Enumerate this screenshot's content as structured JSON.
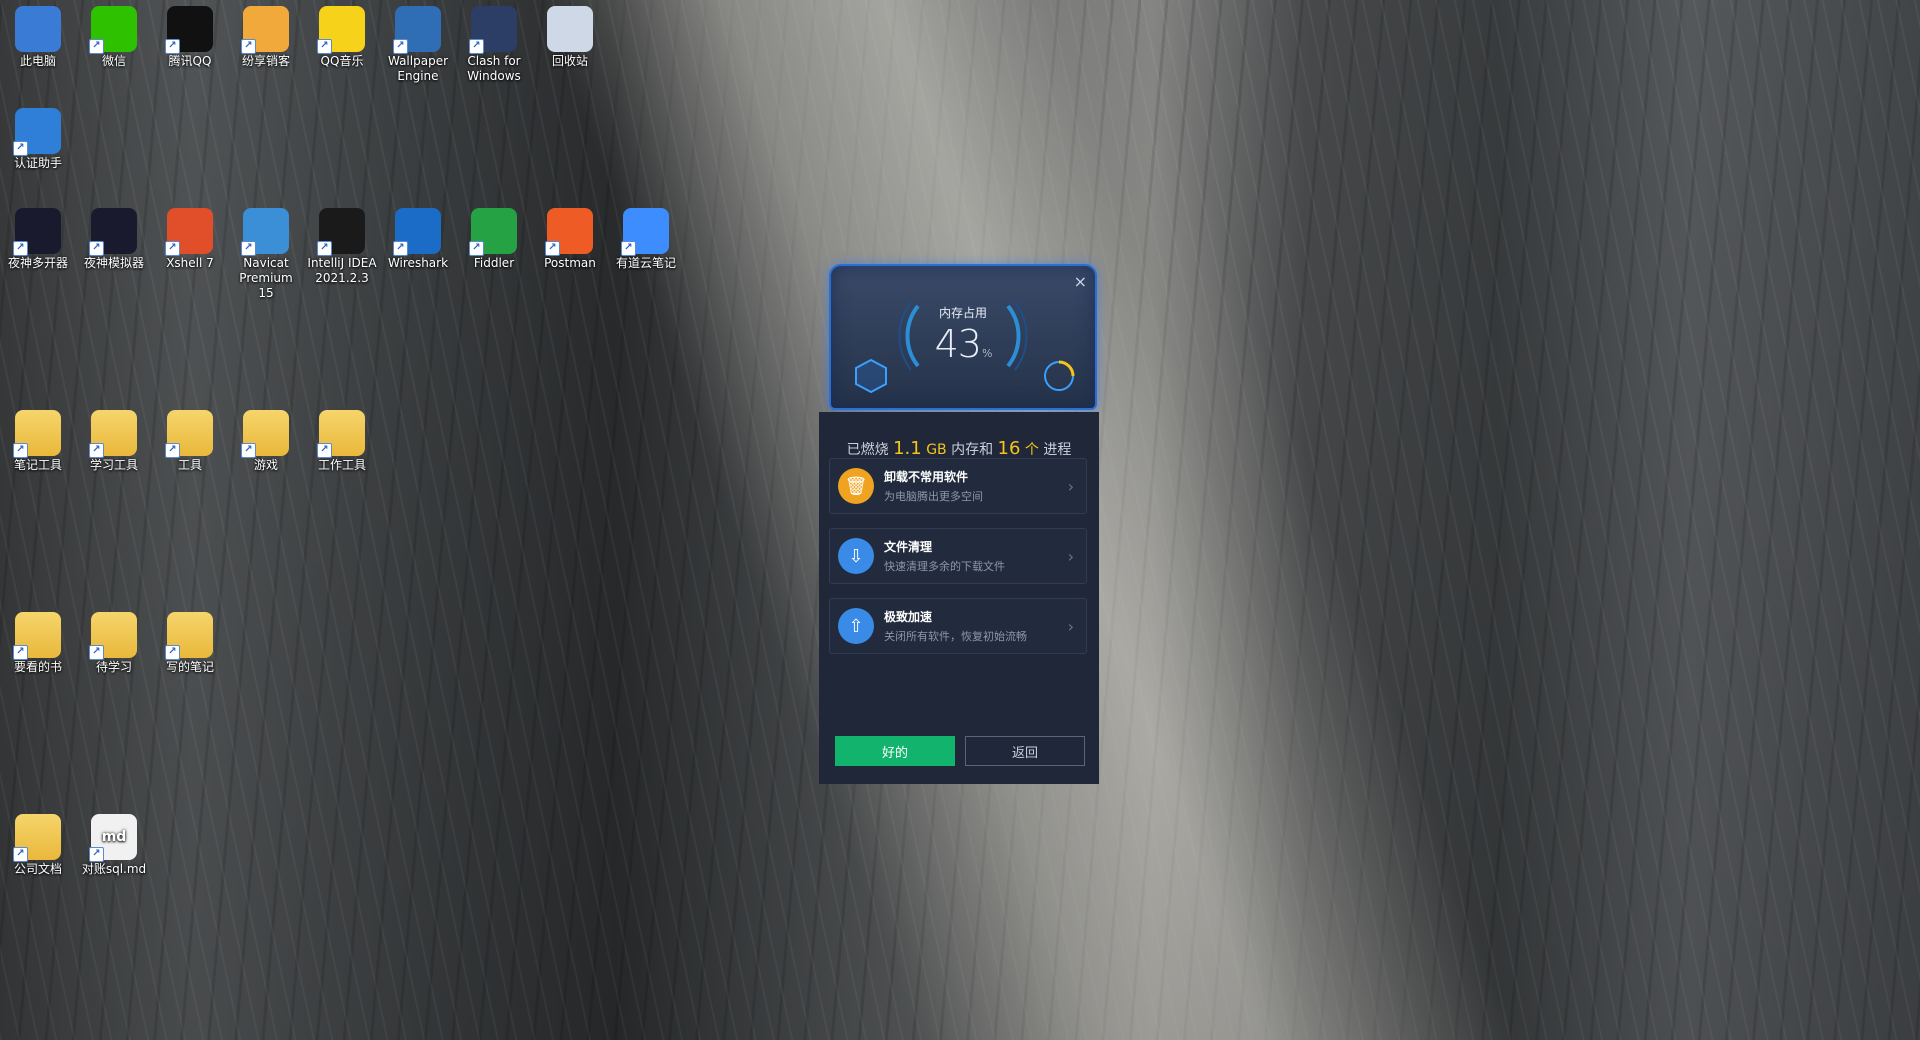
{
  "desktop_icons": [
    {
      "label": "此电脑",
      "kind": "computer",
      "color": "#3a7bd5"
    },
    {
      "label": "微信",
      "kind": "wechat",
      "color": "#2dc100"
    },
    {
      "label": "腾讯QQ",
      "kind": "qq",
      "color": "#111111"
    },
    {
      "label": "纷享销客",
      "kind": "app",
      "color": "#f2a93b"
    },
    {
      "label": "QQ音乐",
      "kind": "music",
      "color": "#f6d21b"
    },
    {
      "label": "Wallpaper\nEngine",
      "kind": "wallpaper",
      "color": "#2f6db5"
    },
    {
      "label": "Clash for\nWindows",
      "kind": "clash",
      "color": "#2c3e66"
    },
    {
      "label": "回收站",
      "kind": "recycle",
      "color": "#cfd8e6"
    },
    {
      "label": "认证助手",
      "kind": "shield",
      "color": "#2f7fd8"
    },
    {
      "label": "夜神多开器",
      "kind": "nox",
      "color": "#1a1a2e"
    },
    {
      "label": "夜神模拟器",
      "kind": "nox",
      "color": "#1a1a2e"
    },
    {
      "label": "Xshell 7",
      "kind": "xshell",
      "color": "#e04e2a"
    },
    {
      "label": "Navicat\nPremium 15",
      "kind": "navicat",
      "color": "#3a8fd6"
    },
    {
      "label": "IntelliJ IDEA\n2021.2.3",
      "kind": "idea",
      "color": "#1a1a1a"
    },
    {
      "label": "Wireshark",
      "kind": "wireshark",
      "color": "#1b6cc6"
    },
    {
      "label": "Fiddler",
      "kind": "fiddler",
      "color": "#25a244"
    },
    {
      "label": "Postman",
      "kind": "postman",
      "color": "#ef5b25"
    },
    {
      "label": "有道云笔记",
      "kind": "youdao",
      "color": "#3d8dff"
    },
    {
      "label": "笔记工具",
      "kind": "folder",
      "color": "#e9b83b"
    },
    {
      "label": "学习工具",
      "kind": "folder",
      "color": "#e9b83b"
    },
    {
      "label": "工具",
      "kind": "folder",
      "color": "#e9b83b"
    },
    {
      "label": "游戏",
      "kind": "folder",
      "color": "#e9b83b"
    },
    {
      "label": "工作工具",
      "kind": "folder",
      "color": "#e9b83b"
    },
    {
      "label": "要看的书",
      "kind": "folder",
      "color": "#e9b83b"
    },
    {
      "label": "待学习",
      "kind": "folder",
      "color": "#e9b83b"
    },
    {
      "label": "写的笔记",
      "kind": "folder",
      "color": "#e9b83b"
    },
    {
      "label": "公司文档",
      "kind": "folder",
      "color": "#e9b83b"
    },
    {
      "label": "对账sql.md",
      "kind": "file",
      "color": "#f1f1f1"
    }
  ],
  "popup": {
    "close_glyph": "×",
    "gauge_label": "内存占用",
    "gauge_value": "43",
    "gauge_unit": "%",
    "summary": {
      "prefix": "已燃烧",
      "amount": "1.1",
      "amount_unit": "GB",
      "middle": "内存和",
      "count": "16",
      "count_unit": "个",
      "suffix": "进程"
    },
    "cards": [
      {
        "title": "卸载不常用软件",
        "subtitle": "为电脑腾出更多空间",
        "icon": "trash-icon",
        "color": "#f0a320"
      },
      {
        "title": "文件清理",
        "subtitle": "快速清理多余的下载文件",
        "icon": "file-clean-icon",
        "color": "#3a8be8"
      },
      {
        "title": "极致加速",
        "subtitle": "关闭所有软件，恢复初始流畅",
        "icon": "speedup-icon",
        "color": "#3a8be8"
      }
    ],
    "ok_label": "好的",
    "back_label": "返回"
  }
}
